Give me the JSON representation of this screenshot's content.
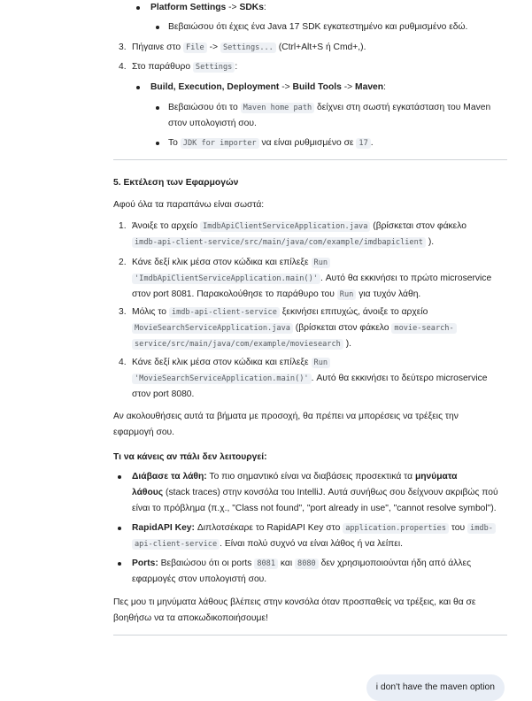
{
  "steps_top": {
    "platform_settings": "Platform Settings",
    "arrow": "->",
    "sdks": "SDKs",
    "sdk_note": "Βεβαιώσου ότι έχεις ένα Java 17 SDK εγκατεστημένο και ρυθμισμένο εδώ.",
    "step3_num": "3.",
    "step3_pre": "Πήγαινε στο",
    "file": "File",
    "settings_dots": "Settings...",
    "step3_post": "(Ctrl+Alt+S ή Cmd+,).",
    "step4_num": "4.",
    "step4_pre": "Στο παράθυρο",
    "settings": "Settings",
    "step4_post": ":",
    "build_path_1": "Build, Execution, Deployment",
    "build_path_2": "Build Tools",
    "build_path_3": "Maven",
    "maven_home_pre": "Βεβαιώσου ότι το",
    "maven_home": "Maven home path",
    "maven_home_post_1": "δείχνει στη σωστή εγκατάσταση του Maven",
    "maven_home_post_2": "στον υπολογιστή σου.",
    "jdk_pre": "Το",
    "jdk_importer": "JDK for importer",
    "jdk_mid": "να είναι ρυθμισμένο σε",
    "jdk_val": "17",
    "jdk_post": "."
  },
  "section5": {
    "title": "5. Εκτέλεση των Εφαρμογών",
    "intro": "Αφού όλα τα παραπάνω είναι σωστά:",
    "s1_num": "1.",
    "s1_pre": "Άνοιξε το αρχείο",
    "s1_file": "ImdbApiClientServiceApplication.java",
    "s1_mid": "(βρίσκεται στον φάκελο",
    "s1_path": "imdb-api-client-service/src/main/java/com/example/imdbapiclient",
    "s1_post": ").",
    "s2_num": "2.",
    "s2_pre": "Κάνε δεξί κλικ μέσα στον κώδικα και επίλεξε",
    "s2_run": "Run",
    "s2_cmd": "'ImdbApiClientServiceApplication.main()'",
    "s2_post1": ". Αυτό θα εκκινήσει το πρώτο microservice",
    "s2_post2": "στον port 8081. Παρακολούθησε το παράθυρο του",
    "s2_run2": "Run",
    "s2_post3": "για τυχόν λάθη.",
    "s3_num": "3.",
    "s3_pre": "Μόλις το",
    "s3_svc": "imdb-api-client-service",
    "s3_mid": "ξεκινήσει επιτυχώς, άνοιξε το αρχείο",
    "s3_file": "MovieSearchServiceApplication.java",
    "s3_mid2": "(βρίσκεται στον φάκελο",
    "s3_path1": "movie-search-",
    "s3_path2": "service/src/main/java/com/example/moviesearch",
    "s3_post": ").",
    "s4_num": "4.",
    "s4_pre": "Κάνε δεξί κλικ μέσα στον κώδικα και επίλεξε",
    "s4_run": "Run",
    "s4_cmd": "'MovieSearchServiceApplication.main()'",
    "s4_post1": ". Αυτό θα εκκινήσει το δεύτερο microservice",
    "s4_post2": "στον port 8080."
  },
  "outro": {
    "line1": "Αν ακολουθήσεις αυτά τα βήματα με προσοχή, θα πρέπει να μπορέσεις να τρέξεις την",
    "line2": "εφαρμογή σου."
  },
  "troubleshoot": {
    "title": "Τι να κάνεις αν πάλι δεν λειτουργεί:",
    "b1_label": "Διάβασε τα λάθη:",
    "b1_text1": "Το πιο σημαντικό είναι να διαβάσεις προσεκτικά τα",
    "b1_bold": "μηνύματα",
    "b1_bold2": "λάθους",
    "b1_text2": "(stack traces) στην κονσόλα του IntelliJ. Αυτά συνήθως σου δείχνουν ακριβώς πού",
    "b1_text3": "είναι το πρόβλημα (π.χ., \"Class not found\", \"port already in use\", \"cannot resolve symbol\").",
    "b2_label": "RapidAPI Key:",
    "b2_text1": "Διπλοτσέκαρε το RapidAPI Key στο",
    "b2_file": "application.properties",
    "b2_text2": "του",
    "b2_svc1": "imdb-",
    "b2_svc2": "api-client-service",
    "b2_text3": ". Είναι πολύ συχνό να είναι λάθος ή να λείπει.",
    "b3_label": "Ports:",
    "b3_text1": "Βεβαιώσου ότι οι ports",
    "b3_p1": "8081",
    "b3_and": "και",
    "b3_p2": "8080",
    "b3_text2": "δεν χρησιμοποιούνται ήδη από άλλες",
    "b3_text3": "εφαρμογές στον υπολογιστή σου."
  },
  "closing": {
    "line1": "Πες μου τι μηνύματα λάθους βλέπεις στην κονσόλα όταν προσπαθείς να τρέξεις, και θα σε",
    "line2": "βοηθήσω να τα αποκωδικοποιήσουμε!"
  },
  "user_message": "i don't have the maven option"
}
